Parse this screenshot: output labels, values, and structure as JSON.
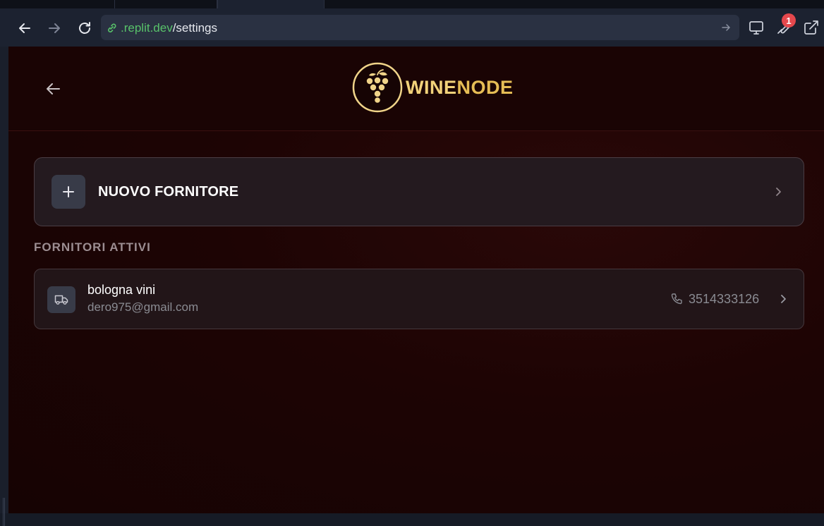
{
  "browser": {
    "url_domain": ".replit.dev",
    "url_path": "/settings",
    "notification_count": "1"
  },
  "app": {
    "logo": {
      "part1": "WINE",
      "part2": "NODE"
    },
    "new_supplier": {
      "label": "NUOVO FORNITORE"
    },
    "section_title": "FORNITORI ATTIVI",
    "suppliers": [
      {
        "name": "bologna vini",
        "email": "dero975@gmail.com",
        "phone": "3514333126"
      }
    ]
  },
  "colors": {
    "brand_gold": "#e6bd55",
    "background": "#1d0404",
    "url_domain": "#58c26a",
    "badge": "#e5484d"
  },
  "icons": [
    "back-arrow-icon",
    "forward-arrow-icon",
    "reload-icon",
    "link-icon",
    "go-arrow-icon",
    "monitor-icon",
    "wrench-icon",
    "external-link-icon",
    "grape-logo-icon",
    "plus-icon",
    "chevron-right-icon",
    "truck-icon",
    "phone-icon"
  ]
}
